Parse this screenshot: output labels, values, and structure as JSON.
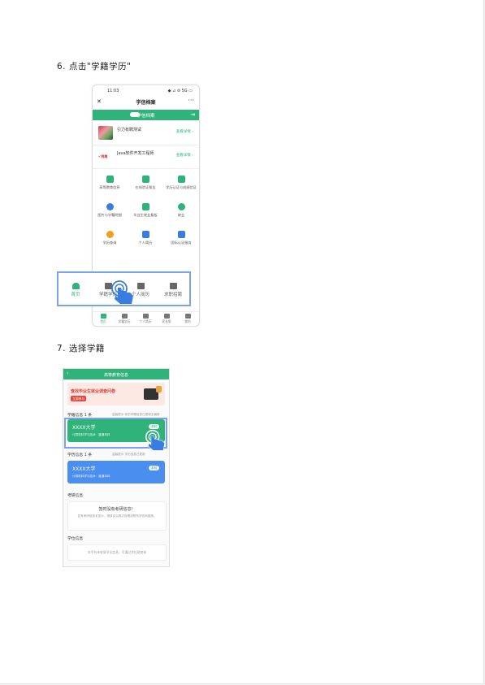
{
  "step6": {
    "title": "6. 点击\"学籍学历\""
  },
  "step7": {
    "title": "7. 选择学籍"
  },
  "phone1": {
    "status_time": "11:03",
    "status_icons": "◆ ⊿ ⊘ 5G ▭",
    "nav_close": "✕",
    "nav_title": "学信档案",
    "nav_more": "···",
    "banner_title": "学信档案",
    "banner_exit": "⇥",
    "rows": [
      {
        "text": "引力有聘测试",
        "button": "查看详情 ›"
      },
      {
        "logo": "✔岗聘",
        "text": "Java软件开发工程师",
        "button": "查看详情 ›"
      }
    ],
    "grid": [
      {
        "label": "高等教育信息",
        "color": "#2fb37a"
      },
      {
        "label": "在线验证报告",
        "color": "#2fb37a"
      },
      {
        "label": "学历认证与成绩验证",
        "color": "#2fb37a"
      },
      {
        "label": "图片与学籍明细",
        "color": "#3a7de0"
      },
      {
        "label": "毕业生就业看板",
        "color": "#2fb37a"
      },
      {
        "label": "就业",
        "color": "#2fb37a"
      },
      {
        "label": "学历查询",
        "color": "#f0a020"
      },
      {
        "label": "个人简历",
        "color": "#3a7de0"
      },
      {
        "label": "国际认证服务",
        "color": "#3a7de0"
      }
    ],
    "tabs": [
      "首页",
      "学籍学历",
      "个人简历",
      "家长版",
      "我的"
    ],
    "highlight_tabs": [
      "首页",
      "学籍学历",
      "个人简历",
      "求职招聘"
    ]
  },
  "phone2": {
    "header_back": "‹",
    "header_title": "高等教育信息",
    "banner_text": "查找毕业生就业调查问卷",
    "banner_button": "立即参与",
    "section_xueji": "学籍信息 1 条",
    "section_xueji_note": "温馨提示 你的学籍信息已更新至最新",
    "card1": {
      "name": "XXXX大学",
      "sub": "计算机科学与技术 · 普通本科",
      "pill": "本科"
    },
    "section_xueli": "学历信息 1 条",
    "section_xueli_note": "温馨提示 学历信息已更新",
    "card2": {
      "name": "XXXX大学",
      "sub": "计算机科学与技术 · 普通本科",
      "pill": "本科"
    },
    "section_kaoyan": "考研信息",
    "kaoyan_title": "暂时没有考研信息！",
    "kaoyan_desc": "如有考研信息未显示，请核实后再次查看或联系学信网客服。",
    "section_xuewei": "学位信息",
    "xuewei_desc": "本平台未收录学位信息，可通过学位网查询"
  },
  "colors": {
    "accent": "#2fb37a",
    "highlight": "#7aa3ea",
    "blue_card": "#4a8ef0"
  }
}
